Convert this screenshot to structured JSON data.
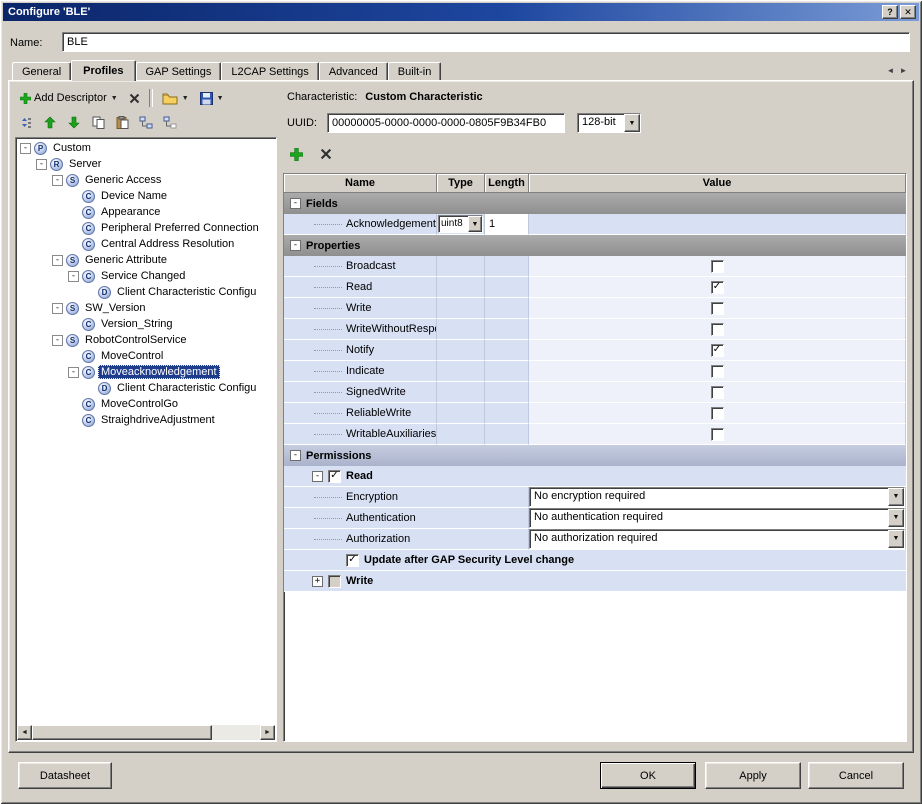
{
  "window": {
    "title": "Configure 'BLE'"
  },
  "icons": {
    "help": "?",
    "close": "✕",
    "dropdown": "▼",
    "check": "✓",
    "expand_open": "-",
    "expand_closed": "+",
    "scroll_left": "◄",
    "scroll_right": "►",
    "tab_prev": "◄",
    "tab_next": "►"
  },
  "colors": {
    "titlebar": "#0b2569",
    "selection": "#1d3c8c",
    "row_blue": "#d8e0f3"
  },
  "name_field": {
    "label": "Name:",
    "value": "BLE"
  },
  "tabs": [
    {
      "label": "General",
      "active": false
    },
    {
      "label": "Profiles",
      "active": true
    },
    {
      "label": "GAP Settings",
      "active": false
    },
    {
      "label": "L2CAP Settings",
      "active": false
    },
    {
      "label": "Advanced",
      "active": false
    },
    {
      "label": "Built-in",
      "active": false
    }
  ],
  "left_panel": {
    "toolbar": {
      "add_descriptor": "Add Descriptor"
    },
    "tree": [
      {
        "depth": 0,
        "icon": "P",
        "label": "Custom",
        "expander": "minus"
      },
      {
        "depth": 1,
        "icon": "R",
        "label": "Server",
        "expander": "minus"
      },
      {
        "depth": 2,
        "icon": "S",
        "label": "Generic Access",
        "expander": "minus"
      },
      {
        "depth": 3,
        "icon": "C",
        "label": "Device Name"
      },
      {
        "depth": 3,
        "icon": "C",
        "label": "Appearance"
      },
      {
        "depth": 3,
        "icon": "C",
        "label": "Peripheral Preferred Connection"
      },
      {
        "depth": 3,
        "icon": "C",
        "label": "Central Address Resolution"
      },
      {
        "depth": 2,
        "icon": "S",
        "label": "Generic Attribute",
        "expander": "minus"
      },
      {
        "depth": 3,
        "icon": "C",
        "label": "Service Changed",
        "expander": "minus"
      },
      {
        "depth": 4,
        "icon": "D",
        "label": "Client Characteristic Configu"
      },
      {
        "depth": 2,
        "icon": "S",
        "label": "SW_Version",
        "expander": "minus"
      },
      {
        "depth": 3,
        "icon": "C",
        "label": "Version_String"
      },
      {
        "depth": 2,
        "icon": "S",
        "label": "RobotControlService",
        "expander": "minus"
      },
      {
        "depth": 3,
        "icon": "C",
        "label": "MoveControl"
      },
      {
        "depth": 3,
        "icon": "C",
        "label": "Moveacknowledgement",
        "expander": "minus",
        "selected": true
      },
      {
        "depth": 4,
        "icon": "D",
        "label": "Client Characteristic Configu"
      },
      {
        "depth": 3,
        "icon": "C",
        "label": "MoveControlGo"
      },
      {
        "depth": 3,
        "icon": "C",
        "label": "StraighdriveAdjustment"
      }
    ]
  },
  "right_panel": {
    "characteristic_label": "Characteristic:",
    "characteristic_name": "Custom Characteristic",
    "uuid_label": "UUID:",
    "uuid_value": "00000005-0000-0000-0000-0805F9B34FB0",
    "uuid_size": "128-bit",
    "grid": {
      "headers": [
        "Name",
        "Type",
        "Length",
        "Value"
      ],
      "rows": [
        {
          "kind": "section",
          "label": "Fields",
          "tone": "dark"
        },
        {
          "kind": "field",
          "name": "Acknowledgement",
          "type": "uint8",
          "length": "1",
          "value": ""
        },
        {
          "kind": "section",
          "label": "Properties",
          "tone": "dark"
        },
        {
          "kind": "prop",
          "name": "Broadcast",
          "checked": false
        },
        {
          "kind": "prop",
          "name": "Read",
          "checked": true
        },
        {
          "kind": "prop",
          "name": "Write",
          "checked": false
        },
        {
          "kind": "prop",
          "name": "WriteWithoutResponse",
          "checked": false
        },
        {
          "kind": "prop",
          "name": "Notify",
          "checked": true
        },
        {
          "kind": "prop",
          "name": "Indicate",
          "checked": false
        },
        {
          "kind": "prop",
          "name": "SignedWrite",
          "checked": false
        },
        {
          "kind": "prop",
          "name": "ReliableWrite",
          "checked": false
        },
        {
          "kind": "prop",
          "name": "WritableAuxiliaries",
          "checked": false
        },
        {
          "kind": "section",
          "label": "Permissions",
          "tone": "light"
        },
        {
          "kind": "perm-parent",
          "label": "Read",
          "checked": true,
          "expanded": true
        },
        {
          "kind": "perm-dropdown",
          "name": "Encryption",
          "value": "No encryption required"
        },
        {
          "kind": "perm-dropdown",
          "name": "Authentication",
          "value": "No authentication required"
        },
        {
          "kind": "perm-dropdown",
          "name": "Authorization",
          "value": "No authorization required"
        },
        {
          "kind": "perm-check",
          "label": "Update after GAP Security Level change",
          "checked": true
        },
        {
          "kind": "perm-parent",
          "label": "Write",
          "checked": false,
          "expanded": false,
          "grayed": true
        }
      ]
    }
  },
  "footer": {
    "datasheet": "Datasheet",
    "ok": "OK",
    "apply": "Apply",
    "cancel": "Cancel"
  }
}
